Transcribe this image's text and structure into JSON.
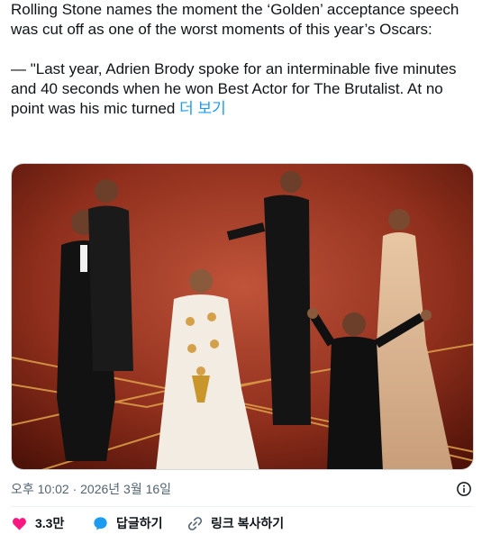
{
  "tweet": {
    "line1": "Rolling Stone names the moment the ‘Golden’ acceptance speech was cut off as one of the worst moments of this year’s Oscars:",
    "line2": "— \"Last year, Adrien Brody spoke for an interminable five minutes and 40 seconds when he won Best Actor for The Brutalist. At no point was his mic turned ",
    "more_link": "더 보기"
  },
  "media": {
    "icon": "photo-image"
  },
  "meta": {
    "timestamp": "오후 10:02 · 2026년 3월 16일",
    "info_icon": "info-icon"
  },
  "actions": {
    "like_count": "3.3만",
    "reply_label": "답글하기",
    "copy_label": "링크 복사하기"
  },
  "colors": {
    "accent": "#1d9bf0",
    "like": "#f91880",
    "text": "#0f1419",
    "muted": "#536471"
  }
}
